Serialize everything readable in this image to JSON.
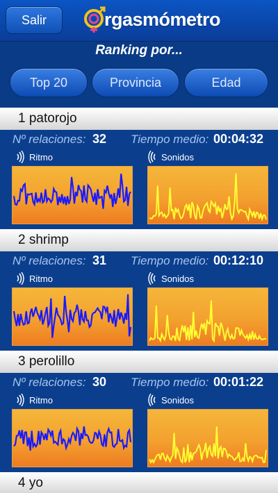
{
  "nav": {
    "back_label": "Salir",
    "logo_text": "rgasmómetro"
  },
  "subtitle": "Ranking por...",
  "tabs": [
    {
      "label": "Top 20"
    },
    {
      "label": "Provincia"
    },
    {
      "label": "Edad"
    }
  ],
  "labels": {
    "relations": "Nº relaciones:",
    "avg_time": "Tiempo medio:",
    "rhythm": "Ritmo",
    "sounds": "Sonidos"
  },
  "colors": {
    "rhythm_line": "#1a1aff",
    "sounds_line": "#ffff33"
  },
  "entries": [
    {
      "title": "1 patorojo",
      "relations": "32",
      "avg_time": "00:04:32"
    },
    {
      "title": "2 shrimp",
      "relations": "31",
      "avg_time": "00:12:10"
    },
    {
      "title": "3 perolillo",
      "relations": "30",
      "avg_time": "00:01:22"
    },
    {
      "title": "4 yo"
    }
  ]
}
